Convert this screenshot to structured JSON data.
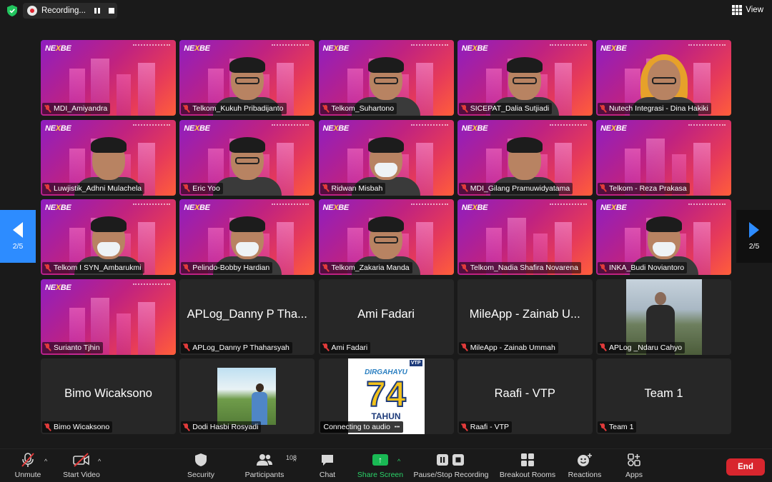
{
  "topbar": {
    "recording_label": "Recording...",
    "view_label": "View"
  },
  "event_logo": {
    "prefix": "NE",
    "mark": "X",
    "suffix": "BE"
  },
  "tiles": [
    {
      "name": "MDI_Amiyandra",
      "type": "event"
    },
    {
      "name": "Telkom_Kukuh Pribadijanto",
      "type": "person",
      "avatar": "glasses"
    },
    {
      "name": "Telkom_Suhartono",
      "type": "person",
      "avatar": "glasses"
    },
    {
      "name": "SICEPAT_Dalia Sutjiadi",
      "type": "person",
      "avatar": "glasses"
    },
    {
      "name": "Nutech Integrasi - Dina Hakiki",
      "type": "person",
      "avatar": "hijab"
    },
    {
      "name": "Luwjistik_Adhni Mulachela",
      "type": "person",
      "avatar": "plain"
    },
    {
      "name": "Eric Yoo",
      "type": "person",
      "avatar": "glasses"
    },
    {
      "name": "Ridwan Misbah",
      "type": "person",
      "avatar": "mask"
    },
    {
      "name": "MDI_Gilang Pramuwidyatama",
      "type": "person",
      "avatar": "plain"
    },
    {
      "name": "Telkom - Reza Prakasa",
      "type": "event"
    },
    {
      "name": "Telkom I SYN_Ambarukmi",
      "type": "person",
      "avatar": "mask"
    },
    {
      "name": "Pelindo-Bobby Hardian",
      "type": "person",
      "avatar": "mask"
    },
    {
      "name": "Telkom_Zakaria Manda",
      "type": "person",
      "avatar": "glasses"
    },
    {
      "name": "Telkom_Nadia Shafira Novarena",
      "type": "event"
    },
    {
      "name": "INKA_Budi Noviantoro",
      "type": "person",
      "avatar": "mask"
    },
    {
      "name": "Surianto Tjhin",
      "type": "event"
    },
    {
      "name": "APLog_Danny P Thaharsyah",
      "type": "text",
      "display": "APLog_Danny P Tha..."
    },
    {
      "name": "Ami Fadari",
      "type": "text",
      "display": "Ami Fadari"
    },
    {
      "name": "MileApp - Zainab Ummah",
      "type": "text",
      "display": "MileApp - Zainab U..."
    },
    {
      "name": "APLog _Ndaru Cahyo",
      "type": "photo-mountain"
    },
    {
      "name": "Bimo Wicaksono",
      "type": "text",
      "display": "Bimo Wicaksono"
    },
    {
      "name": "Dodi Hasbi Rosyadi",
      "type": "photo-golf"
    },
    {
      "name": "Connecting to audio",
      "type": "poster"
    },
    {
      "name": "Raafi - VTP",
      "type": "text",
      "display": "Raafi - VTP"
    },
    {
      "name": "Team 1",
      "type": "text",
      "display": "Team 1"
    }
  ],
  "poster": {
    "top": "DIRGAHAYU",
    "number": "74",
    "bottom": "TAHUN",
    "badge": "VTP"
  },
  "pagination": {
    "left": "2/5",
    "right": "2/5"
  },
  "toolbar": {
    "unmute": "Unmute",
    "start_video": "Start Video",
    "security": "Security",
    "participants": "Participants",
    "participants_count": "108",
    "chat": "Chat",
    "share_screen": "Share Screen",
    "pause_stop": "Pause/Stop Recording",
    "breakout": "Breakout Rooms",
    "reactions": "Reactions",
    "apps": "Apps",
    "end": "End"
  },
  "colors": {
    "accent_blue": "#2d8cff",
    "share_green": "#19b954",
    "end_red": "#d8262e",
    "muted_red": "#e23b3b"
  }
}
